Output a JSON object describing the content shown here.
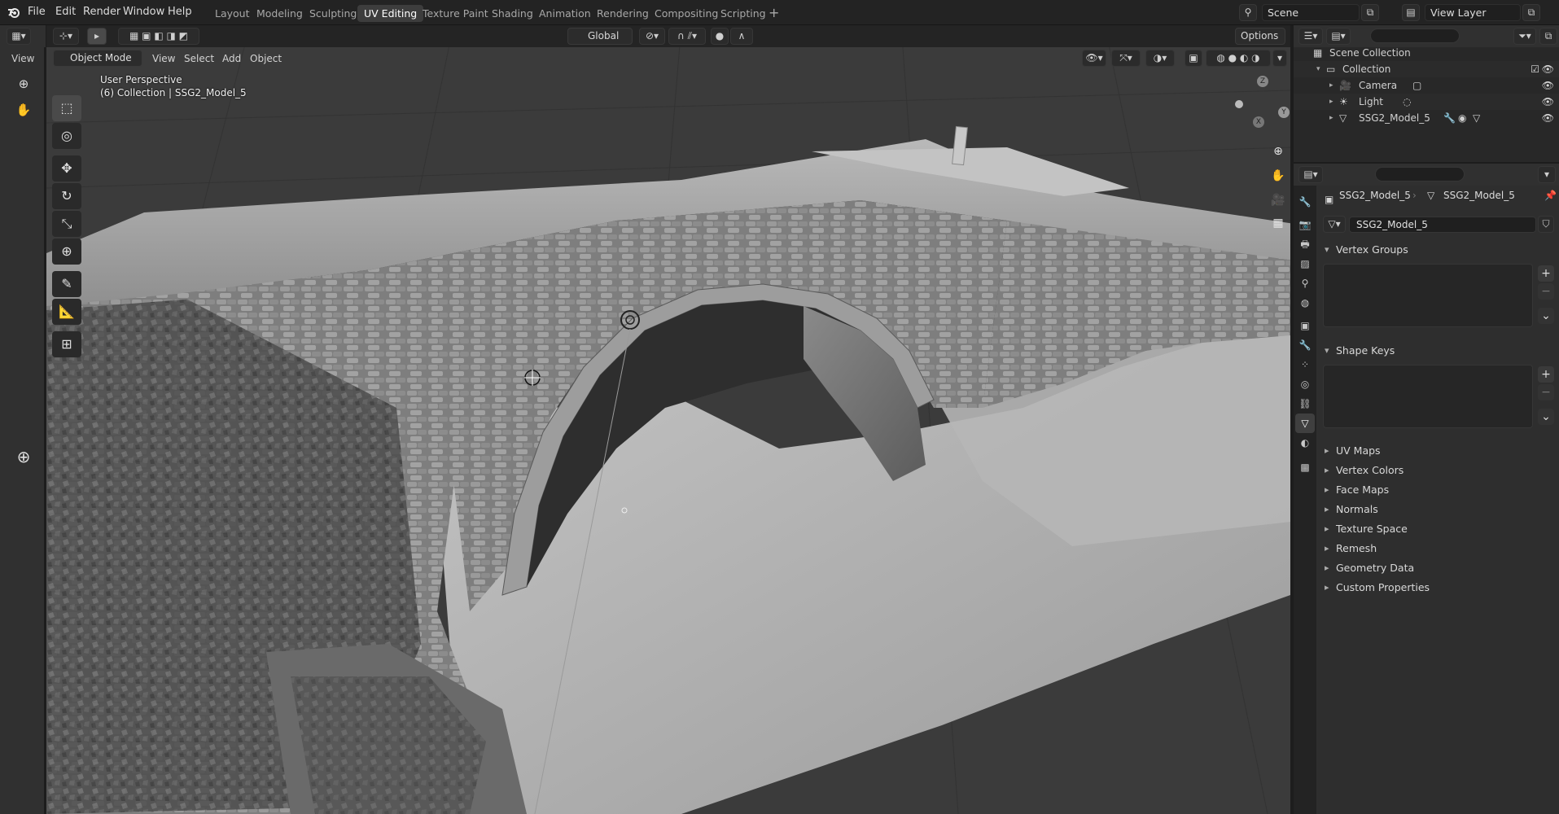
{
  "menu": {
    "items": [
      "File",
      "Edit",
      "Render",
      "Window",
      "Help"
    ]
  },
  "workspaces": {
    "tabs": [
      "Layout",
      "Modeling",
      "Sculpting",
      "UV Editing",
      "Texture Paint",
      "Shading",
      "Animation",
      "Rendering",
      "Compositing",
      "Scripting"
    ],
    "active": "UV Editing"
  },
  "scene": {
    "name": "Scene",
    "view_layer": "View Layer"
  },
  "left_strip": {
    "view_label": "View"
  },
  "viewport": {
    "mode": "Object Mode",
    "menus": [
      "View",
      "Select",
      "Add",
      "Object"
    ],
    "transform_orientation": "Global",
    "options_label": "Options",
    "overlay_line1": "User Perspective",
    "overlay_line2": "(6) Collection | SSG2_Model_5",
    "gizmo_axes": {
      "z": "Z",
      "y": "Y",
      "x": "X"
    }
  },
  "outliner": {
    "search_placeholder": "",
    "rows": [
      {
        "label": "Scene Collection",
        "icon": "scene-collection-icon"
      },
      {
        "label": "Collection",
        "icon": "collection-icon"
      },
      {
        "label": "Camera",
        "icon": "camera-icon"
      },
      {
        "label": "Light",
        "icon": "light-icon"
      },
      {
        "label": "SSG2_Model_5",
        "icon": "mesh-icon"
      }
    ]
  },
  "properties": {
    "breadcrumb_object": "SSG2_Model_5",
    "breadcrumb_mesh": "SSG2_Model_5",
    "mesh_name": "SSG2_Model_5",
    "panels": [
      {
        "label": "Vertex Groups",
        "open": true
      },
      {
        "label": "Shape Keys",
        "open": true
      },
      {
        "label": "UV Maps",
        "open": false
      },
      {
        "label": "Vertex Colors",
        "open": false
      },
      {
        "label": "Face Maps",
        "open": false
      },
      {
        "label": "Normals",
        "open": false
      },
      {
        "label": "Texture Space",
        "open": false
      },
      {
        "label": "Remesh",
        "open": false
      },
      {
        "label": "Geometry Data",
        "open": false
      },
      {
        "label": "Custom Properties",
        "open": false
      }
    ]
  },
  "colors": {
    "accent_active_tab": "#3d3d3d",
    "viewport_bg": "#3b3b3b",
    "gizmo_x": "#e05a5a",
    "gizmo_y": "#8cc63f",
    "gizmo_z": "#5a8ce0"
  }
}
